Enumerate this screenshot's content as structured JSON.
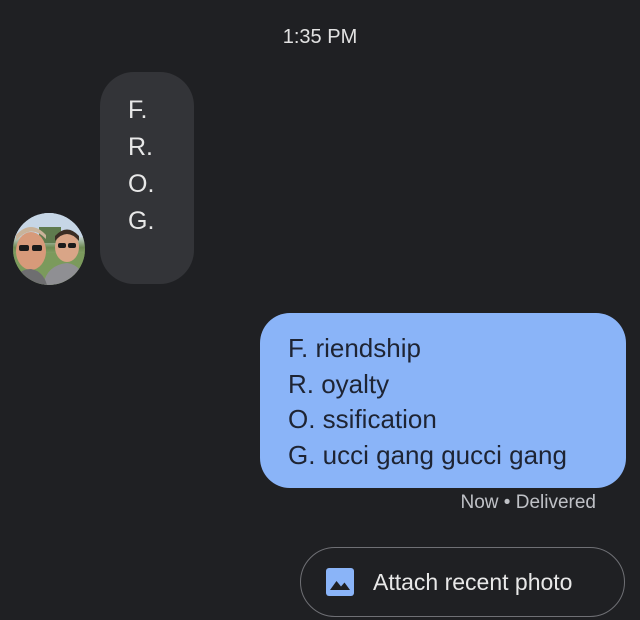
{
  "header": {
    "time": "1:35 PM"
  },
  "incoming_message": {
    "lines": [
      "F.",
      "R.",
      "O.",
      "G."
    ]
  },
  "outgoing_message": {
    "lines": [
      "F. riendship",
      "R. oyalty",
      "O. ssification",
      "G. ucci gang gucci gang"
    ],
    "status": "Now • Delivered"
  },
  "attach_button": {
    "label": "Attach recent photo",
    "icon": "photo-icon"
  },
  "colors": {
    "background": "#1f2023",
    "incoming_bubble": "#333438",
    "outgoing_bubble": "#8ab4f8",
    "accent": "#8ab4f8"
  }
}
